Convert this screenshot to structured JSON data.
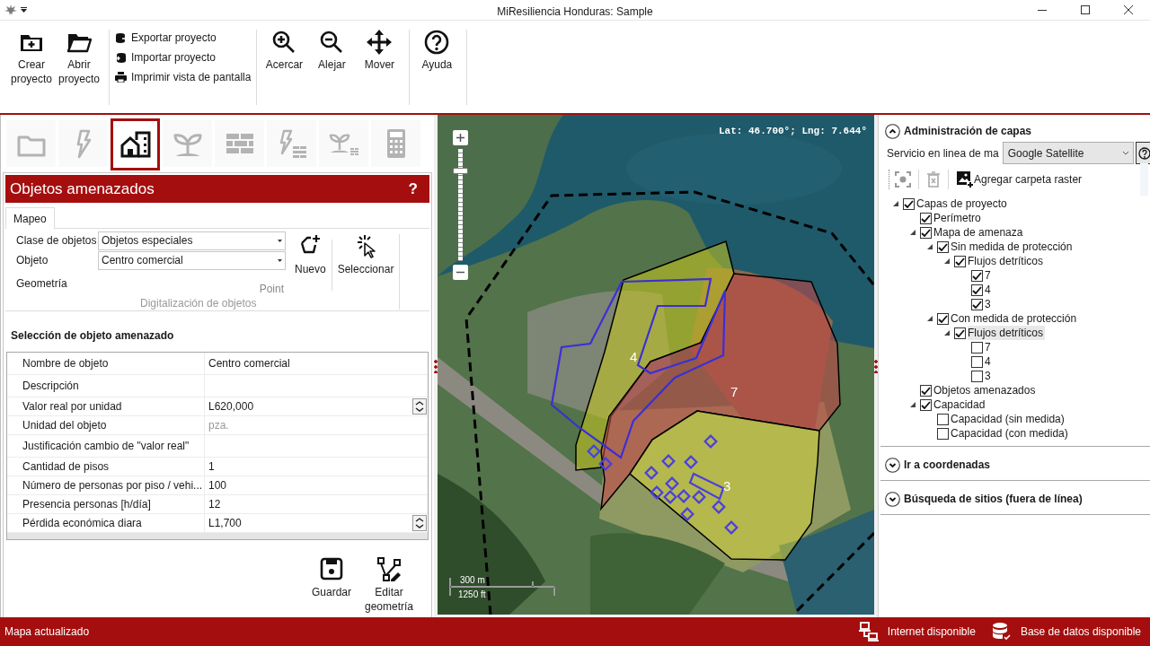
{
  "window": {
    "title": "MiResiliencia Honduras: Sample"
  },
  "ribbon": {
    "groups": [
      {
        "kind": "large",
        "buttons": [
          {
            "label": "Crear proyecto"
          },
          {
            "label": "Abrir proyecto"
          }
        ]
      },
      {
        "kind": "small",
        "buttons": [
          {
            "label": "Exportar proyecto"
          },
          {
            "label": "Importar proyecto"
          },
          {
            "label": "Imprimir vista de pantalla"
          }
        ]
      },
      {
        "kind": "large",
        "buttons": [
          {
            "label": "Acercar"
          },
          {
            "label": "Alejar"
          },
          {
            "label": "Mover"
          }
        ]
      },
      {
        "kind": "large",
        "buttons": [
          {
            "label": "Ayuda"
          }
        ]
      }
    ]
  },
  "left_panel": {
    "module_tabs": [
      {
        "selected": false
      },
      {
        "selected": false
      },
      {
        "selected": true
      },
      {
        "selected": false
      },
      {
        "selected": false
      },
      {
        "selected": false
      },
      {
        "selected": false
      },
      {
        "selected": false
      }
    ],
    "header": {
      "title": "Objetos amenazados",
      "help": "?"
    },
    "tabs": [
      {
        "label": "Mapeo",
        "selected": true
      }
    ],
    "form": {
      "fields": [
        {
          "kind": "dropdown",
          "label": "Clase de objetos",
          "value": "Objetos especiales"
        },
        {
          "kind": "dropdown",
          "label": "Objeto",
          "value": "Centro comercial"
        },
        {
          "kind": "readonly",
          "label": "Geometría",
          "value": "Point"
        }
      ],
      "buttons": [
        {
          "label": "Nuevo"
        },
        {
          "label": "Seleccionar"
        }
      ],
      "group_label": "Digitalización de objetos"
    },
    "selection": {
      "title": "Selección de objeto amenazado",
      "rows": [
        {
          "name": "Nombre de objeto",
          "value": "Centro comercial",
          "dimmed": false,
          "spinner": false
        },
        {
          "name": "Descripción",
          "spinner": false
        },
        {
          "name": "Valor real por unidad",
          "value": "L620,000",
          "dimmed": false,
          "spinner": true
        },
        {
          "name": "Unidad del objeto",
          "value": "pza.",
          "dimmed": true,
          "spinner": false
        },
        {
          "name": "Justificación cambio de \"valor real\"",
          "spinner": false
        },
        {
          "name": "Cantidad de pisos",
          "value": "1",
          "dimmed": false,
          "spinner": false
        },
        {
          "name": "Número de personas por piso / vehi...",
          "value": "100",
          "dimmed": false,
          "spinner": false
        },
        {
          "name": "Presencia personas [h/día]",
          "value": "12",
          "dimmed": false,
          "spinner": false
        },
        {
          "name": "Pérdida económica diara",
          "value": "L1,700",
          "dimmed": false,
          "spinner": true
        }
      ]
    },
    "actions": [
      {
        "label": "Guardar"
      },
      {
        "label": "Editar geometría"
      }
    ]
  },
  "map": {
    "coordinates": "Lat: 46.700°; Lng: 7.644°",
    "zoom_slider": {
      "level": 0.82
    },
    "hazard_zones": [
      {
        "label": "4"
      },
      {
        "label": "7"
      },
      {
        "label": "3"
      }
    ],
    "scale": {
      "metric": "300 m",
      "imperial": "1250 ft"
    }
  },
  "right_panel": {
    "sections": [
      {
        "title": "Administración de capas",
        "expanded": true,
        "service": {
          "label": "Servicio en linea de ma",
          "value": "Google Satellite"
        },
        "toolbar": {
          "add_label": "Agregar carpeta raster"
        },
        "layers": [
          {
            "label": "Capas de proyecto",
            "checked": true,
            "selected": false,
            "expanded": true,
            "children": [
              {
                "label": "Perímetro",
                "checked": true,
                "selected": false
              },
              {
                "label": "Mapa de amenaza",
                "checked": true,
                "selected": false,
                "expanded": true,
                "children": [
                  {
                    "label": "Sin medida de protección",
                    "checked": true,
                    "selected": false,
                    "expanded": true,
                    "children": [
                      {
                        "label": "Flujos detríticos",
                        "checked": true,
                        "selected": false,
                        "expanded": true,
                        "children": [
                          {
                            "label": "7",
                            "checked": true,
                            "selected": false
                          },
                          {
                            "label": "4",
                            "checked": true,
                            "selected": false
                          },
                          {
                            "label": "3",
                            "checked": true,
                            "selected": false
                          }
                        ]
                      }
                    ]
                  },
                  {
                    "label": "Con medida de protección",
                    "checked": true,
                    "selected": false,
                    "expanded": true,
                    "children": [
                      {
                        "label": "Flujos detríticos",
                        "checked": true,
                        "selected": true,
                        "expanded": true,
                        "children": [
                          {
                            "label": "7",
                            "checked": false,
                            "selected": false
                          },
                          {
                            "label": "4",
                            "checked": false,
                            "selected": false
                          },
                          {
                            "label": "3",
                            "checked": false,
                            "selected": false
                          }
                        ]
                      }
                    ]
                  }
                ]
              },
              {
                "label": "Objetos amenazados",
                "checked": true,
                "selected": false
              },
              {
                "label": "Capacidad",
                "checked": true,
                "selected": false,
                "expanded": true,
                "children": [
                  {
                    "label": "Capacidad (sin medida)",
                    "checked": false,
                    "selected": false
                  },
                  {
                    "label": "Capacidad (con medida)",
                    "checked": false,
                    "selected": false
                  }
                ]
              }
            ]
          }
        ]
      },
      {
        "title": "Ir a coordenadas",
        "expanded": false
      },
      {
        "title": "Búsqueda de sitios (fuera de línea)",
        "expanded": false
      }
    ]
  },
  "status_bar": {
    "message": "Mapa actualizado",
    "indicators": [
      {
        "label": "Internet disponible"
      },
      {
        "label": "Base de datos disponible"
      }
    ]
  }
}
